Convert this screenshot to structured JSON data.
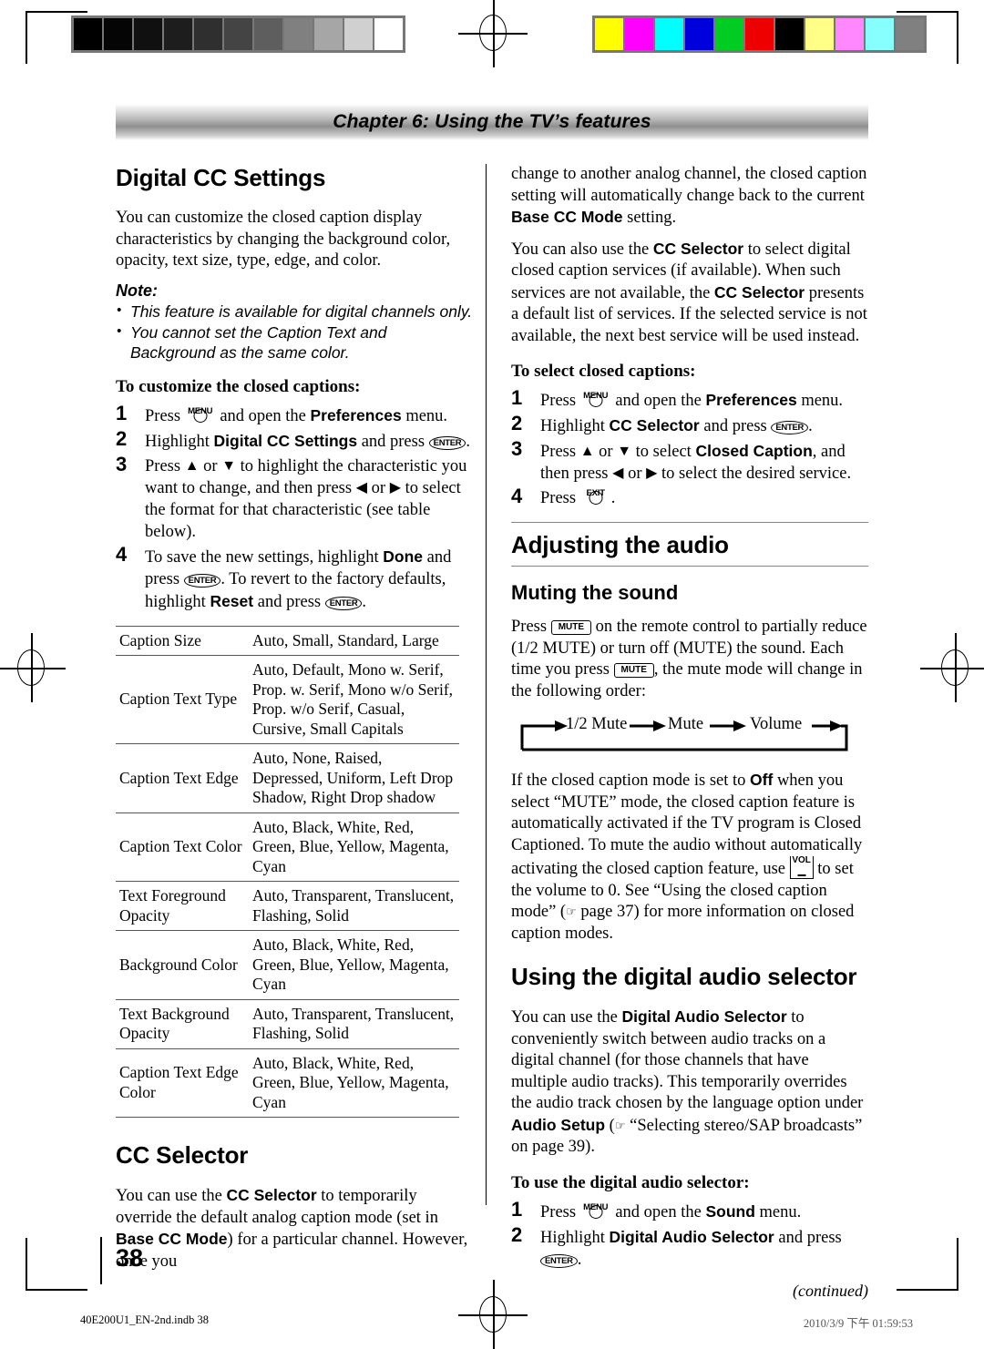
{
  "header": {
    "chapter_title": "Chapter 6: Using the TV’s features"
  },
  "calibration": {
    "gray_bar": [
      "#000000",
      "#050505",
      "#101010",
      "#1d1d1d",
      "#2f2f2f",
      "#444444",
      "#5e5e5e",
      "#808080",
      "#a6a6a6",
      "#d0d0d0",
      "#ffffff"
    ],
    "color_bar": [
      "#ffff00",
      "#ff00ff",
      "#00ffff",
      "#0000dd",
      "#00cc22",
      "#ee0000",
      "#000000",
      "#ffff88",
      "#ff88ff",
      "#88ffff",
      "#808080"
    ]
  },
  "left_column": {
    "heading": "Digital CC Settings",
    "intro": "You can customize the closed caption display characteristics by changing the background color, opacity, text size, type, edge, and color.",
    "note_label": "Note:",
    "notes": [
      "This feature is available for digital channels only.",
      "You cannot set the Caption Text and Background as the same color."
    ],
    "procedure_title": "To customize the closed captions:",
    "steps": [
      {
        "num": "1",
        "pre": "Press ",
        "key": "MENU",
        "mid": " and open the ",
        "bold": "Preferences",
        "post": " menu."
      },
      {
        "num": "2",
        "pre": "Highlight ",
        "bold": "Digital CC Settings",
        "mid2": " and press ",
        "key2": "ENTER",
        "post": "."
      },
      {
        "num": "3",
        "text": "Press ▲ or ▼ to highlight the characteristic you want to change, and then press ◀ or ▶ to select the format for that characteristic (see table below)."
      },
      {
        "num": "4",
        "text": "To save the new settings, highlight Done and press ENTER. To revert to the factory defaults, highlight Reset and press ENTER."
      }
    ],
    "table": {
      "rows": [
        {
          "key": "Caption Size",
          "value": "Auto, Small, Standard, Large"
        },
        {
          "key": "Caption Text Type",
          "value": "Auto, Default, Mono w. Serif, Prop. w. Serif, Mono w/o Serif, Prop. w/o Serif, Casual, Cursive, Small Capitals"
        },
        {
          "key": "Caption Text Edge",
          "value": "Auto, None, Raised, Depressed, Uniform, Left Drop Shadow, Right Drop shadow"
        },
        {
          "key": "Caption Text Color",
          "value": "Auto, Black, White, Red, Green, Blue, Yellow, Magenta, Cyan"
        },
        {
          "key": "Text Foreground Opacity",
          "value": "Auto, Transparent, Translucent, Flashing, Solid"
        },
        {
          "key": "Background Color",
          "value": "Auto, Black, White, Red, Green, Blue, Yellow, Magenta, Cyan"
        },
        {
          "key": "Text Background Opacity",
          "value": "Auto, Transparent, Translucent, Flashing, Solid"
        },
        {
          "key": "Caption Text Edge Color",
          "value": "Auto, Black, White, Red, Green, Blue, Yellow, Magenta, Cyan"
        }
      ]
    },
    "cc_selector_heading": "CC Selector",
    "cc_selector_text": "You can use the CC Selector to temporarily override the default analog caption mode (set in Base CC Mode) for a particular channel. However, once you"
  },
  "right_column": {
    "continued_text": "change to another analog channel, the closed caption setting will automatically change back to the current Base CC Mode setting.",
    "paragraph2": "You can also use the CC Selector to select digital closed caption services (if available). When such services are not available, the CC Selector presents a default list of services. If the selected service is not available, the next best service will be used instead.",
    "procedure_title": "To select closed captions:",
    "steps": [
      {
        "num": "1",
        "text": "Press MENU and open the Preferences menu."
      },
      {
        "num": "2",
        "text": "Highlight CC Selector and press ENTER."
      },
      {
        "num": "3",
        "text": "Press ▲ or ▼ to select Closed Caption, and then press ◀ or ▶ to select the desired service."
      },
      {
        "num": "4",
        "text": "Press EXIT."
      }
    ],
    "audio_heading": "Adjusting the audio",
    "mute_heading": "Muting the sound",
    "mute_text": "Press MUTE on the remote control to partially reduce (1/2 MUTE) or turn off (MUTE) the sound. Each time you press MUTE, the mute mode will change in the following order:",
    "mute_cycle": [
      "1/2 Mute",
      "Mute",
      "Volume"
    ],
    "mute_note": "If the closed caption mode is set to Off when you select “MUTE” mode, the closed caption feature is automatically activated if the TV program is Closed Captioned. To mute the audio without automatically activating the closed caption feature, use VOL- to set the volume to 0. See “Using the closed caption mode” (☞ page 37) for more information on closed caption modes.",
    "das_heading": "Using the digital audio selector",
    "das_text": "You can use the Digital Audio Selector to conveniently switch between audio tracks on a digital channel (for those channels that have multiple audio tracks). This temporarily overrides the audio track chosen by the language option under Audio Setup (☞ “Selecting stereo/SAP broadcasts” on page 39).",
    "das_procedure_title": "To use the digital audio selector:",
    "das_steps": [
      {
        "num": "1",
        "text": "Press MENU and open the Sound menu."
      },
      {
        "num": "2",
        "text": "Highlight Digital Audio Selector and press ENTER."
      }
    ],
    "continued_label": "(continued)"
  },
  "footer": {
    "page_number": "38",
    "file_name": "40E200U1_EN-2nd.indb  38",
    "timestamp": "2010/3/9   下午 01:59:53"
  },
  "keys": {
    "menu": "MENU",
    "exit": "EXIT",
    "enter": "ENTER",
    "mute": "MUTE",
    "vol": "VOL"
  }
}
